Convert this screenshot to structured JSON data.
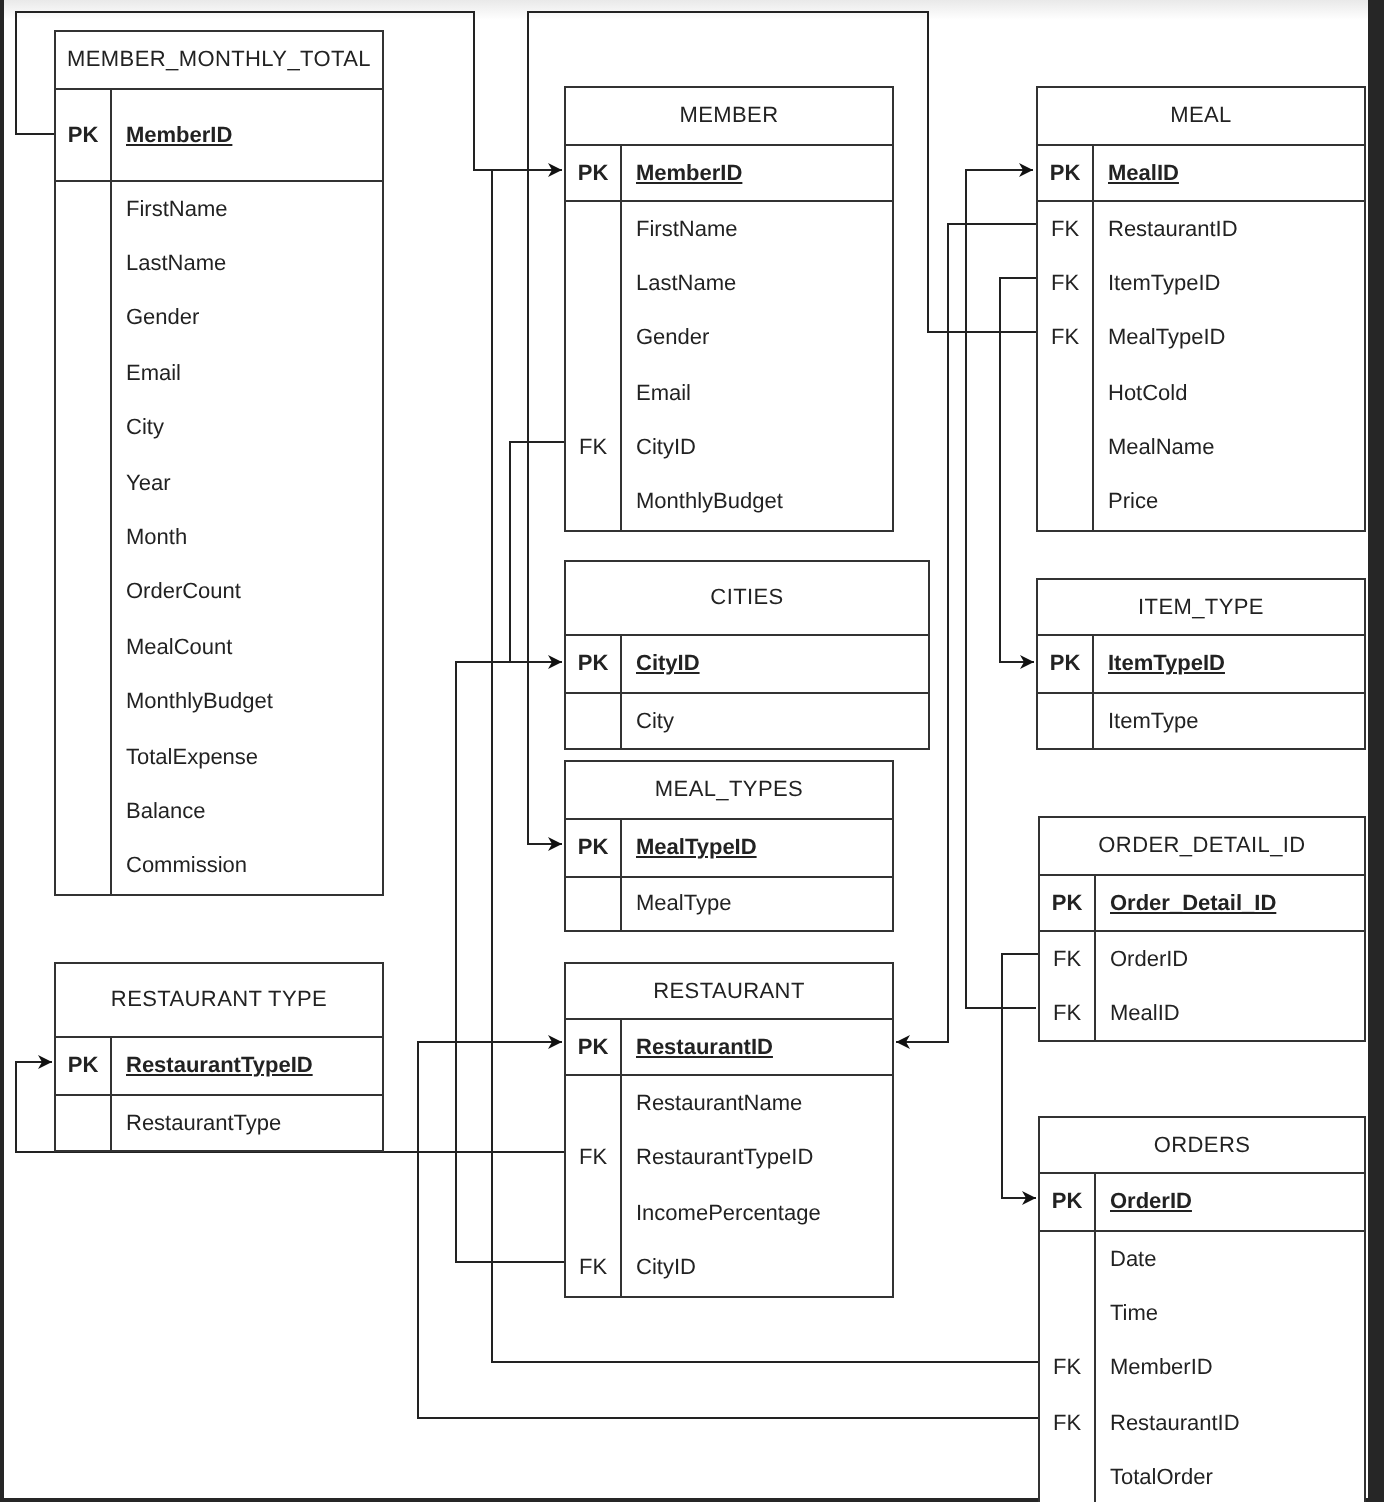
{
  "tables": [
    {
      "title": "MEMBER_MONTHLY_TOTAL",
      "rows": [
        {
          "key": "PK",
          "field": "MemberID",
          "primary": true
        },
        {
          "field": "FirstName",
          "primary": false
        },
        {
          "field": "LastName",
          "primary": false
        },
        {
          "field": "Gender",
          "primary": false
        },
        {
          "field": "Email",
          "primary": false
        },
        {
          "field": "City",
          "primary": false
        },
        {
          "field": "Year",
          "primary": false
        },
        {
          "field": "Month",
          "primary": false
        },
        {
          "field": "OrderCount",
          "primary": false
        },
        {
          "field": "MealCount",
          "primary": false
        },
        {
          "field": "MonthlyBudget",
          "primary": false
        },
        {
          "field": "TotalExpense",
          "primary": false
        },
        {
          "field": "Balance",
          "primary": false
        },
        {
          "field": "Commission",
          "primary": false
        }
      ]
    },
    {
      "title": "MEMBER",
      "rows": [
        {
          "key": "PK",
          "field": "MemberID",
          "primary": true
        },
        {
          "field": "FirstName",
          "primary": false
        },
        {
          "field": "LastName",
          "primary": false
        },
        {
          "field": "Gender",
          "primary": false
        },
        {
          "field": "Email",
          "primary": false
        },
        {
          "key": "FK",
          "field": "CityID",
          "primary": false
        },
        {
          "field": "MonthlyBudget",
          "primary": false
        }
      ]
    },
    {
      "title": "MEAL",
      "rows": [
        {
          "key": "PK",
          "field": "MealID",
          "primary": true
        },
        {
          "key": "FK",
          "field": "RestaurantID",
          "primary": false
        },
        {
          "key": "FK",
          "field": "ItemTypeID",
          "primary": false
        },
        {
          "key": "FK",
          "field": "MealTypeID",
          "primary": false
        },
        {
          "field": "HotCold",
          "primary": false
        },
        {
          "field": "MealName",
          "primary": false
        },
        {
          "field": "Price",
          "primary": false
        }
      ]
    },
    {
      "title": "CITIES",
      "rows": [
        {
          "key": "PK",
          "field": "CityID",
          "primary": true
        },
        {
          "field": "City",
          "primary": false
        }
      ]
    },
    {
      "title": "ITEM_TYPE",
      "rows": [
        {
          "key": "PK",
          "field": "ItemTypeID",
          "primary": true
        },
        {
          "field": "ItemType",
          "primary": false
        }
      ]
    },
    {
      "title": "MEAL_TYPES",
      "rows": [
        {
          "key": "PK",
          "field": "MealTypeID",
          "primary": true
        },
        {
          "field": "MealType",
          "primary": false
        }
      ]
    },
    {
      "title": "ORDER_DETAIL_ID",
      "rows": [
        {
          "key": "PK",
          "field": "Order_Detail_ID",
          "primary": true
        },
        {
          "key": "FK",
          "field": "OrderID",
          "primary": false
        },
        {
          "key": "FK",
          "field": "MealID",
          "primary": false
        }
      ]
    },
    {
      "title": "RESTAURANT TYPE",
      "rows": [
        {
          "key": "PK",
          "field": "RestaurantTypeID",
          "primary": true
        },
        {
          "field": "RestaurantType",
          "primary": false
        }
      ]
    },
    {
      "title": "RESTAURANT",
      "rows": [
        {
          "key": "PK",
          "field": "RestaurantID",
          "primary": true
        },
        {
          "field": "RestaurantName",
          "primary": false
        },
        {
          "key": "FK",
          "field": "RestaurantTypeID",
          "primary": false
        },
        {
          "field": "IncomePercentage",
          "primary": false
        },
        {
          "key": "FK",
          "field": "CityID",
          "primary": false
        }
      ]
    },
    {
      "title": "ORDERS",
      "rows": [
        {
          "key": "PK",
          "field": "OrderID",
          "primary": true
        },
        {
          "field": "Date",
          "primary": false
        },
        {
          "field": "Time",
          "primary": false
        },
        {
          "key": "FK",
          "field": "MemberID",
          "primary": false
        },
        {
          "key": "FK",
          "field": "RestaurantID",
          "primary": false
        },
        {
          "field": "TotalOrder",
          "primary": false
        }
      ]
    }
  ]
}
